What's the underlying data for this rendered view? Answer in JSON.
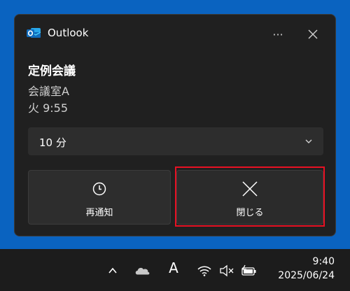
{
  "notification": {
    "app_name": "Outlook",
    "more_label": "···",
    "title": "定例会議",
    "location": "会議室A",
    "time": "火 9:55",
    "snooze_select": {
      "selected": "10 分"
    },
    "snooze_button_label": "再通知",
    "dismiss_button_label": "閉じる"
  },
  "taskbar": {
    "ime_label": "A",
    "clock_time": "9:40",
    "clock_date": "2025/06/24"
  },
  "colors": {
    "desktop": "#0a63c0",
    "toast_bg": "#202020",
    "button_bg": "#2d2d2d",
    "highlight": "#e81123",
    "outlook_blue": "#0f6cbd"
  }
}
